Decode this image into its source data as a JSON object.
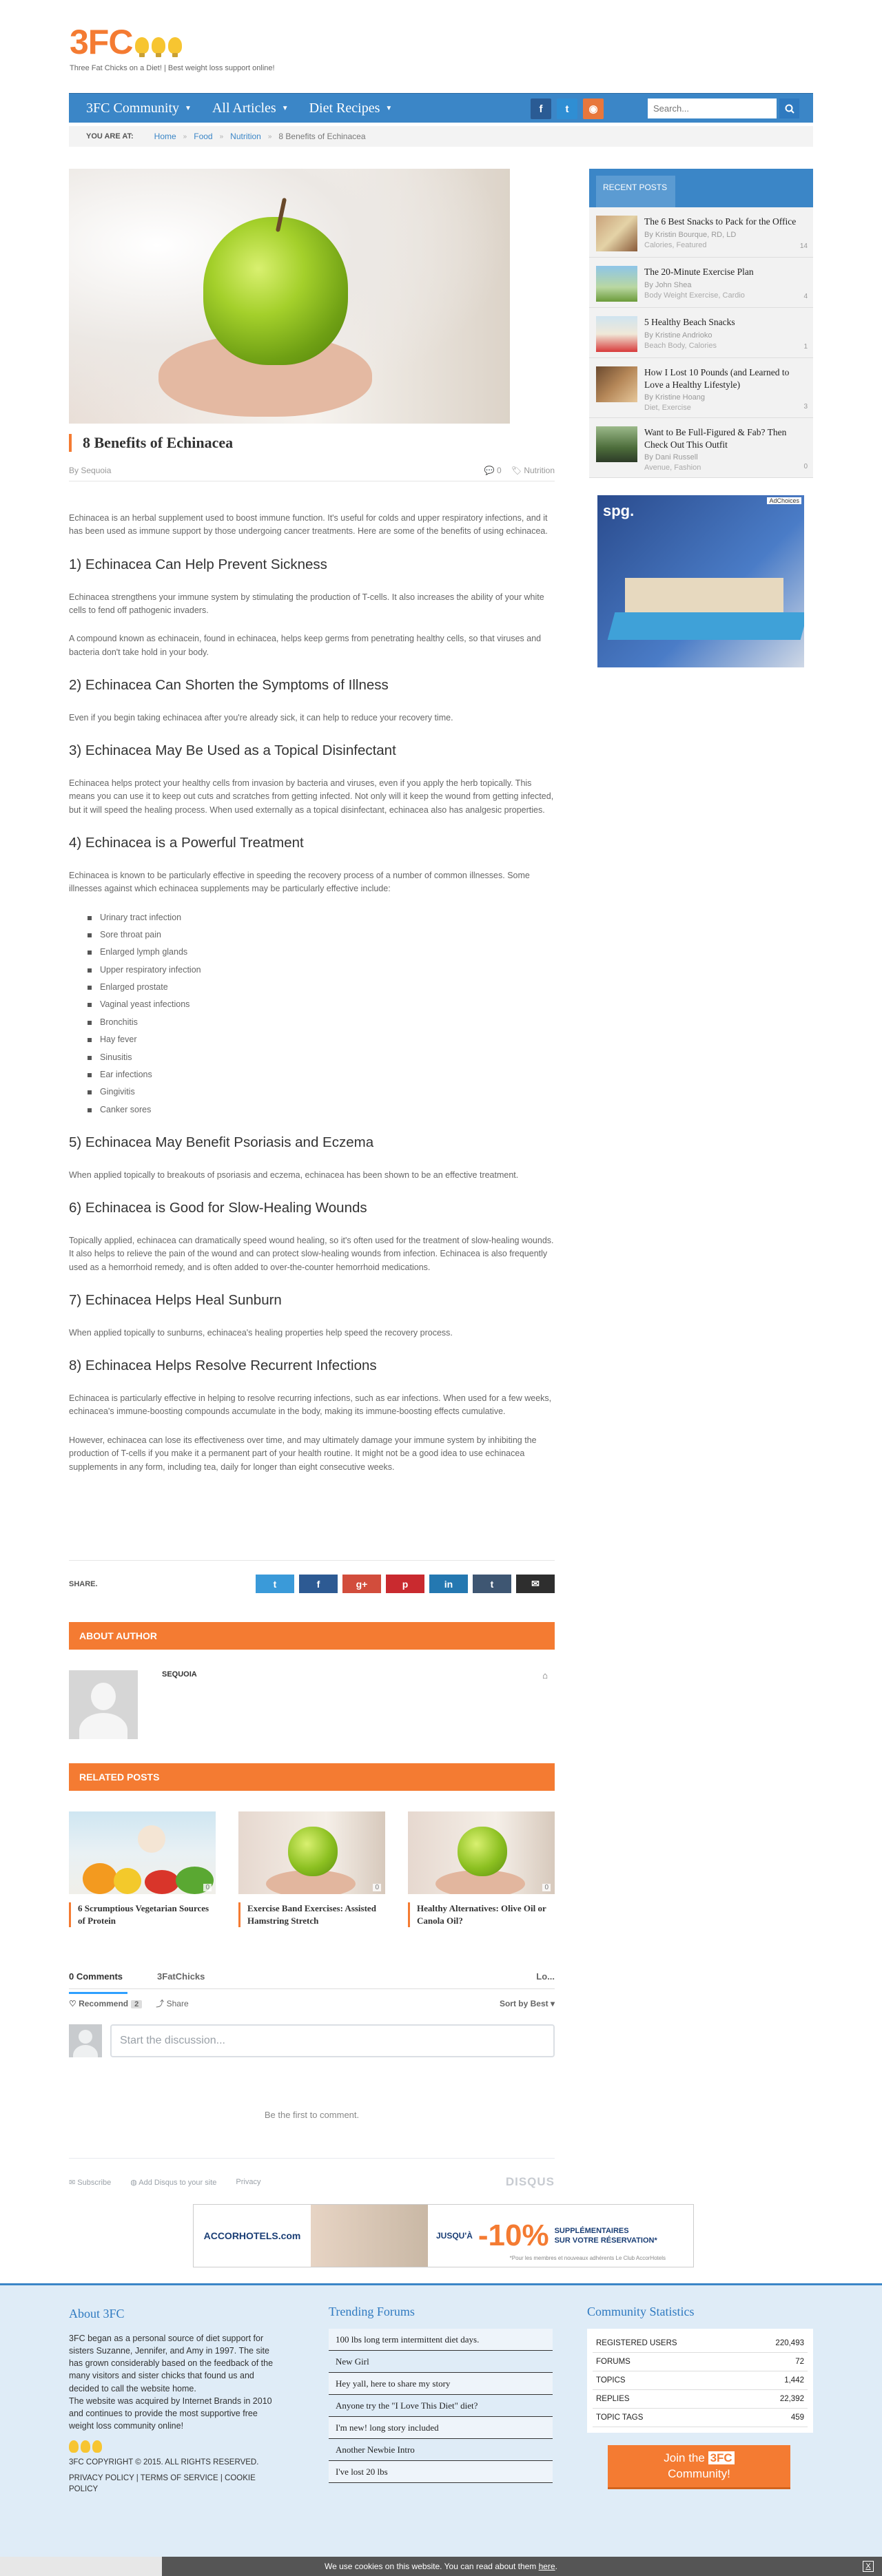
{
  "header": {
    "logo_text": "3FC",
    "tagline": "Three Fat Chicks on a Diet! | Best weight loss support online!"
  },
  "nav": {
    "items": [
      "3FC Community",
      "All Articles",
      "Diet Recipes"
    ],
    "social": [
      "f",
      "t",
      "rss"
    ],
    "search_placeholder": "Search..."
  },
  "breadcrumb": {
    "label": "YOU ARE AT:",
    "items": [
      "Home",
      "Food",
      "Nutrition",
      "8 Benefits of Echinacea"
    ]
  },
  "post": {
    "title": "8 Benefits of Echinacea",
    "author": "By Sequoia",
    "comments": "0",
    "category": "Nutrition",
    "intro": "Echinacea is an herbal supplement used to boost immune function. It's useful for colds and upper respiratory infections, and it has been used as immune support by those undergoing cancer treatments. Here are some of the benefits of using echinacea.",
    "h1": "1) Echinacea Can Help Prevent Sickness",
    "p1a": "Echinacea strengthens your immune system by stimulating the production of T-cells. It also increases the ability of your white cells to fend off pathogenic invaders.",
    "p1b": "A compound known as echinacein, found in echinacea, helps keep germs from penetrating healthy cells, so that viruses and bacteria don't take hold in your body.",
    "h2": "2) Echinacea Can Shorten the Symptoms of Illness",
    "p2": "Even if you begin taking echinacea after you're already sick, it can help to reduce your recovery time.",
    "h3": "3) Echinacea May Be Used as a Topical Disinfectant",
    "p3": "Echinacea helps protect your healthy cells from invasion by bacteria and viruses, even if you apply the herb topically. This means you can use it to keep out cuts and scratches from getting infected. Not only will it keep the wound from getting infected, but it will speed the healing process. When used externally as a topical disinfectant, echinacea also has analgesic properties.",
    "h4": "4) Echinacea is a Powerful Treatment",
    "p4": "Echinacea is known to be particularly effective in speeding the recovery process of a number of common illnesses. Some illnesses against which echinacea supplements may be particularly effective include:",
    "list": [
      "Urinary tract infection",
      "Sore throat pain",
      "Enlarged lymph glands",
      "Upper respiratory infection",
      "Enlarged prostate",
      "Vaginal yeast infections",
      "Bronchitis",
      "Hay fever",
      "Sinusitis",
      "Ear infections",
      "Gingivitis",
      "Canker sores"
    ],
    "h5": "5) Echinacea May Benefit Psoriasis and Eczema",
    "p5": "When applied topically to breakouts of psoriasis and eczema, echinacea has been shown to be an effective treatment.",
    "h6": "6) Echinacea is Good for Slow-Healing Wounds",
    "p6": "Topically applied, echinacea can dramatically speed wound healing, so it's often used for the treatment of slow-healing wounds. It also helps to relieve the pain of the wound and can protect slow-healing wounds from infection. Echinacea is also frequently used as a hemorrhoid remedy, and is often added to over-the-counter hemorrhoid medications.",
    "h7": "7) Echinacea Helps Heal Sunburn",
    "p7": "When applied topically to sunburns, echinacea's healing properties help speed the recovery process.",
    "h8": "8)  Echinacea Helps Resolve Recurrent Infections",
    "p8a": "Echinacea is particularly effective in helping to resolve recurring infections, such as ear infections. When used for a few weeks, echinacea's immune-boosting compounds accumulate in the body, making its immune-boosting effects cumulative.",
    "p8b": "However, echinacea can lose its effectiveness over time, and may ultimately damage your immune system by inhibiting the production of T-cells if you make it a permanent part of your health routine. It might not be a good idea to use echinacea supplements in any form, including tea, daily for longer than eight consecutive weeks."
  },
  "share": {
    "label": "SHARE.",
    "buttons": [
      "t",
      "f",
      "g+",
      "p",
      "in",
      "t",
      "✉"
    ]
  },
  "about_author": {
    "heading": "ABOUT AUTHOR",
    "name": "SEQUOIA"
  },
  "related": {
    "heading": "RELATED POSTS",
    "posts": [
      {
        "title": "6 Scrumptious Vegetarian Sources of Protein",
        "comments": "0"
      },
      {
        "title": "Exercise Band Exercises: Assisted Hamstring Stretch",
        "comments": "0"
      },
      {
        "title": "Healthy Alternatives: Olive Oil or Canola Oil?",
        "comments": "0"
      }
    ]
  },
  "disqus": {
    "tab_comments": "0 Comments",
    "tab_site": "3FatChicks",
    "login": "Lo...",
    "recommend": "Recommend",
    "recommend_count": "2",
    "share": "Share",
    "sort": "Sort by Best",
    "placeholder": "Start the discussion...",
    "first": "Be the first to comment.",
    "subscribe": "Subscribe",
    "add_disqus": "Add Disqus to your site",
    "privacy": "Privacy",
    "logo": "DISQUS"
  },
  "ad_banner": {
    "brand": "ACCORHOTELS.com",
    "jusqua": "JUSQU'À",
    "percent": "-10%",
    "sub1": "SUPPLÉMENTAIRES",
    "sub2": "SUR VOTRE RÉSERVATION*",
    "fine": "*Pour les membres et nouveaux adhérents Le Club AccorHotels"
  },
  "sidebar": {
    "recent_label": "RECENT POSTS",
    "posts": [
      {
        "title": "The 6 Best Snacks to Pack for the Office",
        "by": "By Kristin Bourque, RD, LD",
        "cat": "Calories, Featured",
        "comments": "14"
      },
      {
        "title": "The 20-Minute Exercise Plan",
        "by": "By John Shea",
        "cat": "Body Weight Exercise, Cardio",
        "comments": "4"
      },
      {
        "title": "5 Healthy Beach Snacks",
        "by": "By Kristine Andrioko",
        "cat": "Beach Body, Calories",
        "comments": "1"
      },
      {
        "title": "How I Lost 10 Pounds (and Learned to Love a Healthy Lifestyle)",
        "by": "By Kristine Hoang",
        "cat": "Diet, Exercise",
        "comments": "3"
      },
      {
        "title": "Want to Be Full-Figured & Fab? Then Check Out This Outfit",
        "by": "By Dani Russell",
        "cat": "Avenue, Fashion",
        "comments": "0"
      }
    ],
    "ad_choices": "AdChoices",
    "ad_brand": "spg."
  },
  "footer": {
    "about_heading": "About 3FC",
    "about_text1": "3FC began as a personal source of diet support for sisters Suzanne, Jennifer, and Amy in 1997. The site has grown considerably based on the feedback of the many visitors and sister chicks that found us and decided to call the website home.",
    "about_text2": "The website was acquired by Internet Brands in 2010 and continues to provide the most supportive free weight loss community online!",
    "copyright": "3FC COPYRIGHT © 2015. ALL RIGHTS RESERVED.",
    "links": "PRIVACY POLICY | TERMS OF SERVICE | COOKIE POLICY",
    "forums_heading": "Trending Forums",
    "forums": [
      "100 lbs long term intermittent diet days.",
      "New Girl",
      "Hey yall, here to share my story",
      "Anyone try the \"I Love This Diet\" diet?",
      "I'm new! long story included",
      "Another Newbie Intro",
      "I've lost 20 lbs"
    ],
    "stats_heading": "Community Statistics",
    "stats": [
      {
        "label": "REGISTERED USERS",
        "value": "220,493"
      },
      {
        "label": "FORUMS",
        "value": "72"
      },
      {
        "label": "TOPICS",
        "value": "1,442"
      },
      {
        "label": "REPLIES",
        "value": "22,392"
      },
      {
        "label": "TOPIC TAGS",
        "value": "459"
      }
    ],
    "join1": "Join the",
    "join_logo": "3FC",
    "join2": "Community!"
  },
  "cookie": {
    "text": "We use cookies on this website. You can read about them ",
    "link": "here",
    "close": "X"
  },
  "colors": {
    "accent_orange": "#f47b32",
    "nav_blue": "#3b86c7",
    "footer_bg": "#dfecf7"
  }
}
